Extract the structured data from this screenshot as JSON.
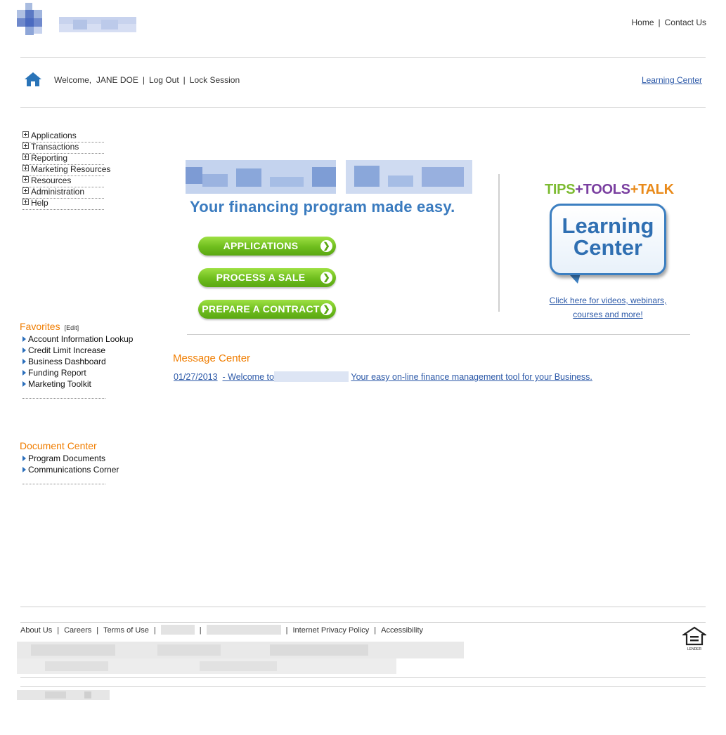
{
  "header": {
    "top_links": [
      "Home",
      "Contact Us"
    ],
    "welcome_prefix": "Welcome,",
    "user_name": "JANE DOE",
    "logout": "Log Out",
    "lock_session": "Lock Session",
    "learning_center_link": "Learning Center"
  },
  "nav": {
    "items": [
      "Applications",
      "Transactions",
      "Reporting",
      "Marketing Resources",
      "Resources",
      "Administration",
      "Help"
    ]
  },
  "favorites": {
    "title": "Favorites",
    "edit": "[Edit]",
    "items": [
      "Account Information Lookup",
      "Credit Limit Increase",
      "Business Dashboard",
      "Funding Report",
      "Marketing Toolkit"
    ]
  },
  "documents": {
    "title": "Document Center",
    "items": [
      "Program Documents",
      "Communications Corner"
    ]
  },
  "banner": {
    "tagline": "Your financing program made easy.",
    "buttons": [
      "APPLICATIONS",
      "PROCESS A SALE",
      "PREPARE A CONTRACT"
    ],
    "ttt_tips": "TIPS",
    "ttt_tools": "TOOLS",
    "ttt_talk": "TALK",
    "bubble_line1": "Learning",
    "bubble_line2": "Center",
    "caption_line1": "Click here for videos, webinars,",
    "caption_line2": "courses and more!"
  },
  "message_center": {
    "title": "Message Center",
    "date": "01/27/2013",
    "prefix": "- Welcome to",
    "suffix": "Your easy on-line finance management tool for your Business."
  },
  "footer": {
    "links": [
      "About Us",
      "Careers",
      "Terms of Use",
      "Internet Privacy Policy",
      "Accessibility"
    ],
    "equal_housing": "LENDER"
  },
  "colors": {
    "accent_orange": "#f07d00",
    "link_blue": "#2c59a8",
    "button_green": "#6ebd1d"
  }
}
